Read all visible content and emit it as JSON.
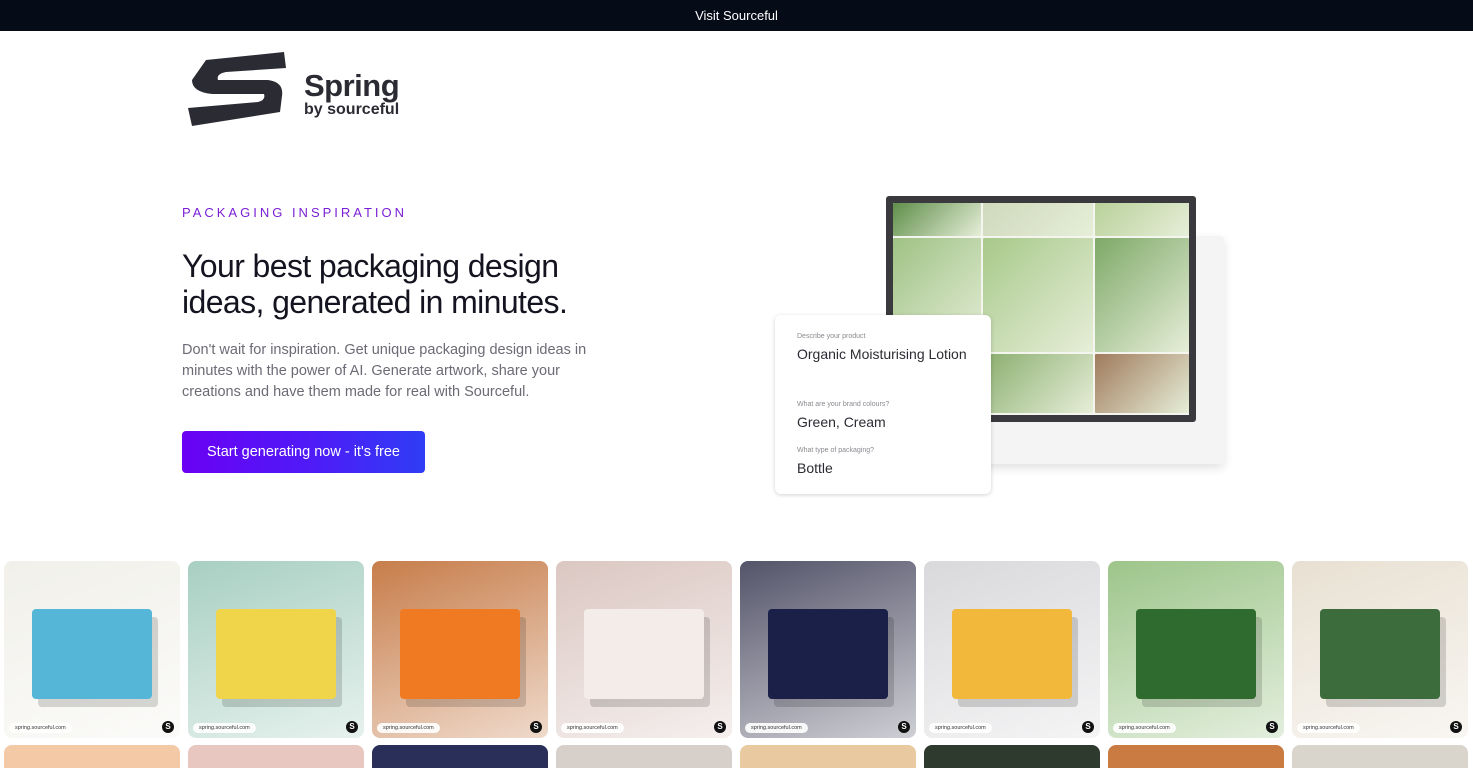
{
  "topbar": {
    "link_label": "Visit Sourceful"
  },
  "logo": {
    "wordmark": "Spring",
    "subline": "by sourceful"
  },
  "hero": {
    "eyebrow": "PACKAGING INSPIRATION",
    "headline": "Your best packaging design ideas, generated in minutes.",
    "description": "Don't wait for inspiration. Get unique packaging design ideas in minutes with the power of AI. Generate artwork, share your creations and have them made for real with Sourceful.",
    "cta_label": "Start generating now - it's free"
  },
  "form_card": {
    "fields": [
      {
        "label": "Describe your product",
        "value": "Organic Moisturising Lotion"
      },
      {
        "label": "What are your brand colours?",
        "value": "Green, Cream"
      },
      {
        "label": "What type of packaging?",
        "value": "Bottle"
      }
    ]
  },
  "gallery": {
    "watermark": "spring.sourceful.com",
    "mark_glyph": "S",
    "row1": [
      {
        "subject": "puzzle-box",
        "bg": "#f1f0ea",
        "accent": "#56b6d8"
      },
      {
        "subject": "pastel-boxes",
        "bg": "#a8cfc2",
        "accent": "#f0d54a"
      },
      {
        "subject": "flower-box",
        "bg": "#c77d4a",
        "accent": "#f07a22"
      },
      {
        "subject": "pink-gift-boxes",
        "bg": "#dbc7c2",
        "accent": "#f3ece8"
      },
      {
        "subject": "navy-boxes",
        "bg": "#54546a",
        "accent": "#1b2048"
      },
      {
        "subject": "navy-gold-set",
        "bg": "#d9d9dc",
        "accent": "#f2b83c"
      },
      {
        "subject": "beer-cans",
        "bg": "#9dc58a",
        "accent": "#2f6b2f"
      },
      {
        "subject": "green-boxes",
        "bg": "#e8e0d2",
        "accent": "#3c6b3c"
      }
    ],
    "row2": [
      {
        "bg": "#f4c9a6"
      },
      {
        "bg": "#e8c7c0"
      },
      {
        "bg": "#2a2f5a"
      },
      {
        "bg": "#d7cfc9"
      },
      {
        "bg": "#e8c9a0"
      },
      {
        "bg": "#2e3a2e"
      },
      {
        "bg": "#c97b42"
      },
      {
        "bg": "#d9d4cc"
      }
    ]
  },
  "monitor": {
    "cells": [
      "#5f8e4a",
      "#cfd9bc",
      "#b9d19a",
      "#9fc285",
      "#a8c98a",
      "#7ea968",
      "#b7d09c",
      "#8aae6e",
      "#a07b5c"
    ]
  }
}
